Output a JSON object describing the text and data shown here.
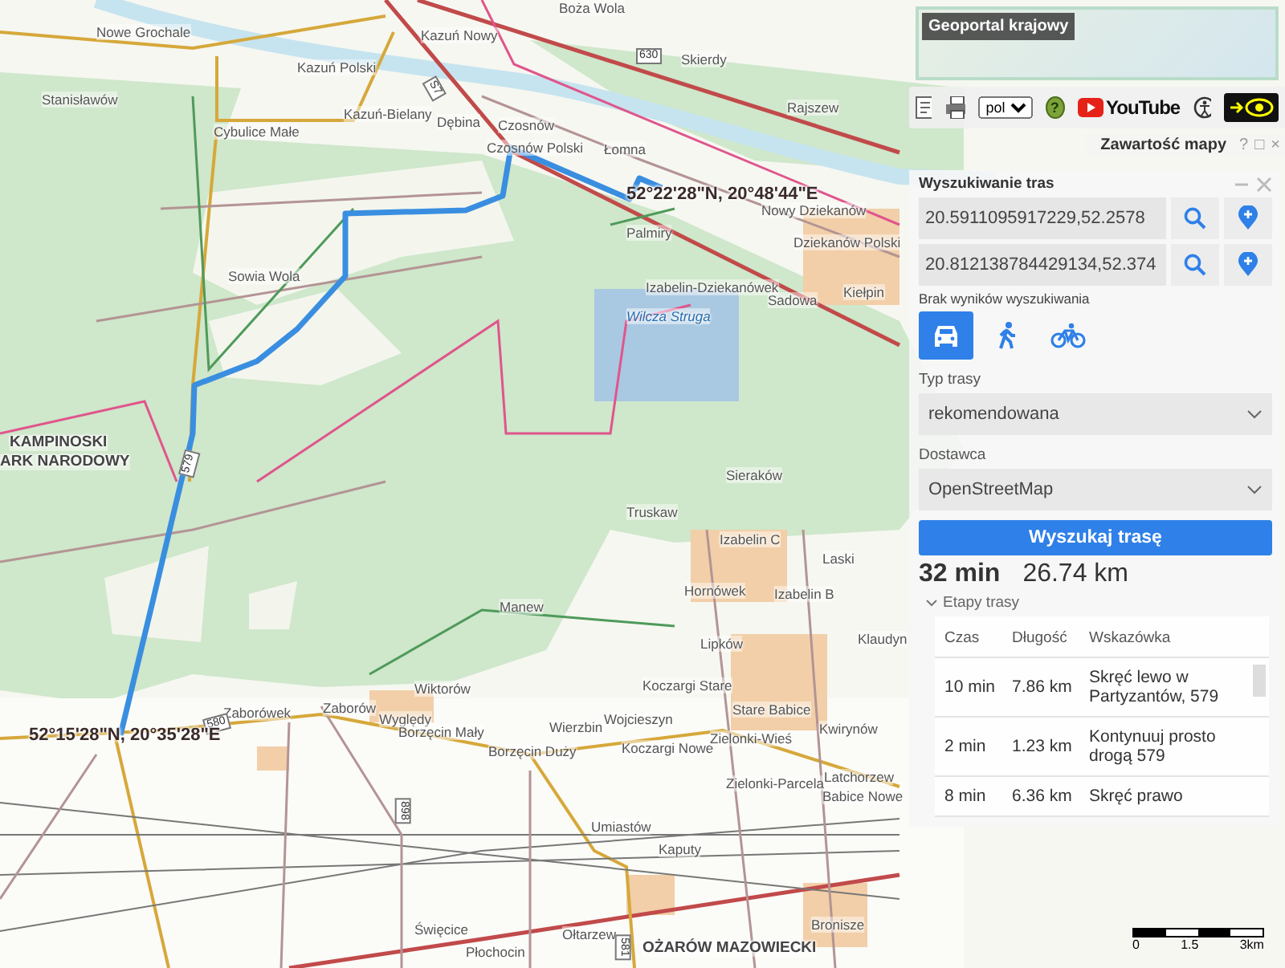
{
  "map": {
    "places": [
      "Nowe Grochale",
      "Kazuń Nowy",
      "Kazuń Polski",
      "Stanisławów",
      "Kazuń-Bielany",
      "Cybulice Małe",
      "Dębina",
      "Czosnów",
      "Czosnów Polski",
      "Łomna",
      "Skierdy",
      "Rajszew",
      "Boża Wola",
      "Nowy Dziekanów",
      "Palmiry",
      "Dziekanów Polski",
      "Sowia Wola",
      "Izabelin-Dziekanówek",
      "Sadowa",
      "Kiełpin",
      "Wilcza Struga",
      "KAMPINOSKI",
      "ARK NARODOWY",
      "Sieraków",
      "Truskaw",
      "Izabelin C",
      "Laski",
      "Hornówek",
      "Izabelin B",
      "Manew",
      "Lipków",
      "Klaudyn",
      "Wiktorów",
      "Koczargi Stare",
      "Stare Babice",
      "Kwirynów",
      "Zaborówek",
      "Zaborów",
      "Wyględy",
      "Borzęcin Mały",
      "Wierzbin",
      "Borzęcin Duży",
      "Wojcieszyn",
      "Koczargi Nowe",
      "Zielonki-Wieś",
      "Latchorzew",
      "Zielonki-Parcela",
      "Babice Nowe",
      "Umiastów",
      "Kaputy",
      "Święcice",
      "Ołtarzew",
      "Płochocin",
      "OŻARÓW MAZOWIECKI",
      "Bronisze"
    ],
    "road_numbers": [
      "630",
      "S7",
      "579",
      "580",
      "898",
      "581"
    ],
    "coordinates": [
      "52°22'28\"N, 20°48'44\"E",
      "52°15'28\"N, 20°35'28\"E"
    ],
    "scale": [
      "0",
      "1.5",
      "3km"
    ]
  },
  "overview": {
    "title": "Geoportal krajowy"
  },
  "toolbar": {
    "language": "pol",
    "help": "?",
    "video_label": "YouTube"
  },
  "layers_window": {
    "title": "Zawartość mapy",
    "controls": [
      "?",
      "□",
      "×"
    ]
  },
  "route_search": {
    "title": "Wyszukiwanie tras",
    "start": {
      "value": "20.5911095917229,52.2578"
    },
    "end": {
      "value": "20.812138784429134,52.374"
    },
    "status": "Brak wyników wyszukiwania",
    "modes": [
      {
        "kind": "car",
        "selected": true
      },
      {
        "kind": "walk",
        "selected": false
      },
      {
        "kind": "bike",
        "selected": false
      }
    ],
    "route_type": {
      "label": "Typ trasy",
      "value": "rekomendowana"
    },
    "provider": {
      "label": "Dostawca",
      "value": "OpenStreetMap"
    },
    "search_button": "Wyszukaj trasę",
    "summary": {
      "time": "32 min",
      "distance": "26.74 km"
    },
    "stages": {
      "label": "Etapy trasy",
      "expanded": true,
      "columns": [
        "Czas",
        "Długość",
        "Wskazówka"
      ],
      "rows": [
        [
          "10 min",
          "7.86 km",
          "Skręć lewo w Partyzantów, 579"
        ],
        [
          "2 min",
          "1.23 km",
          "Kontynuuj prosto drogą 579"
        ],
        [
          "8 min",
          "6.36 km",
          "Skręć prawo"
        ]
      ]
    }
  }
}
